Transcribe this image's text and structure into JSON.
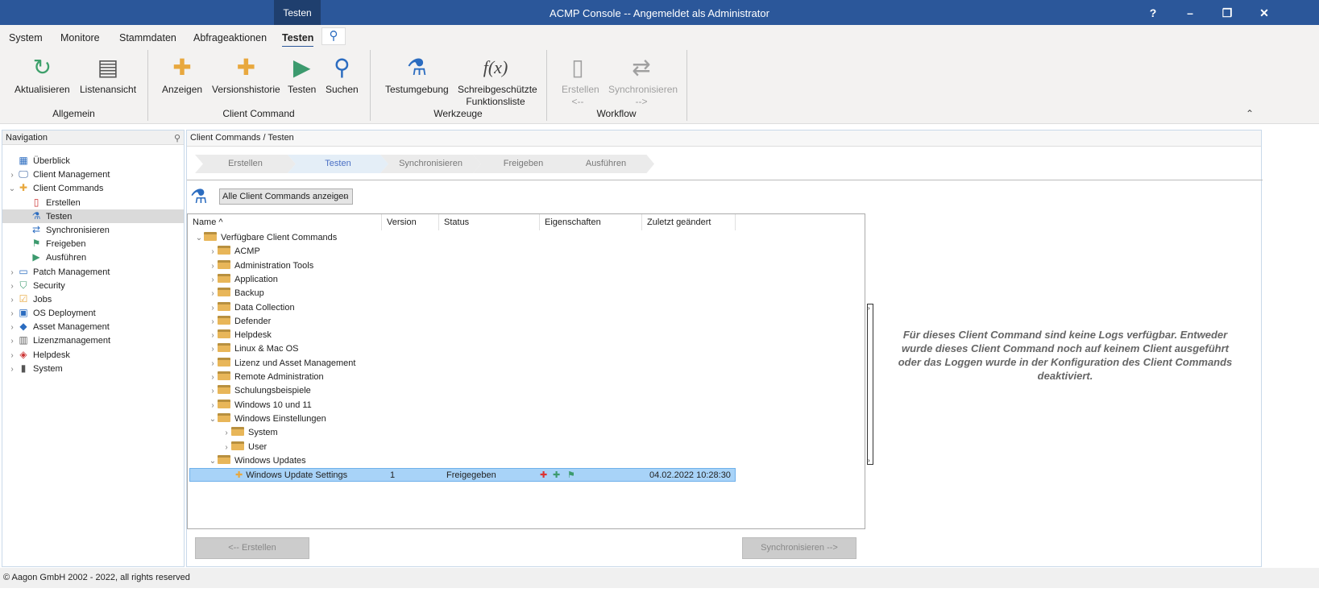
{
  "window": {
    "context_tab": "Testen",
    "title": "ACMP Console -- Angemeldet als Administrator",
    "help": "?",
    "minimize": "–",
    "restore": "❐",
    "close": "✕"
  },
  "menu": {
    "tabs": [
      "System",
      "Monitore",
      "Stammdaten",
      "Abfrageaktionen",
      "Testen"
    ],
    "active": "Testen"
  },
  "ribbon": {
    "buttons": [
      {
        "label": "Aktualisieren",
        "icon": "refresh-icon"
      },
      {
        "label": "Listenansicht",
        "icon": "list-view-icon"
      },
      {
        "label": "Anzeigen",
        "icon": "puzzle-search-icon"
      },
      {
        "label": "Versionshistorie",
        "icon": "puzzle-info-icon"
      },
      {
        "label": "Testen",
        "icon": "play-icon"
      },
      {
        "label": "Suchen",
        "icon": "search-icon"
      },
      {
        "label": "Testumgebung",
        "icon": "flask-gear-icon"
      },
      {
        "label": "Schreibgeschützte Funktionsliste",
        "icon": "function-search-icon"
      },
      {
        "label": "Erstellen <--",
        "icon": "document-icon",
        "disabled": true
      },
      {
        "label": "Synchronisieren -->",
        "icon": "sync-arrows-icon",
        "disabled": true
      }
    ],
    "groups": [
      "Allgemein",
      "Client Command",
      "Werkzeuge",
      "Workflow"
    ]
  },
  "navigation": {
    "title": "Navigation",
    "items": [
      {
        "label": "Überblick",
        "icon": "overview-icon",
        "level": 0,
        "chevron": ""
      },
      {
        "label": "Client Management",
        "icon": "monitor-icon",
        "level": 0,
        "chevron": ">"
      },
      {
        "label": "Client Commands",
        "icon": "puzzle-icon",
        "level": 0,
        "chevron": "v"
      },
      {
        "label": "Erstellen",
        "icon": "document-icon",
        "level": 1,
        "chevron": ""
      },
      {
        "label": "Testen",
        "icon": "flask-icon",
        "level": 1,
        "chevron": "",
        "selected": true
      },
      {
        "label": "Synchronisieren",
        "icon": "sync-icon",
        "level": 1,
        "chevron": ""
      },
      {
        "label": "Freigeben",
        "icon": "flag-icon",
        "level": 1,
        "chevron": ""
      },
      {
        "label": "Ausführen",
        "icon": "play-icon",
        "level": 1,
        "chevron": ""
      },
      {
        "label": "Patch Management",
        "icon": "patch-icon",
        "level": 0,
        "chevron": ">"
      },
      {
        "label": "Security",
        "icon": "shield-icon",
        "level": 0,
        "chevron": ">"
      },
      {
        "label": "Jobs",
        "icon": "clipboard-icon",
        "level": 0,
        "chevron": ">"
      },
      {
        "label": "OS Deployment",
        "icon": "deploy-icon",
        "level": 0,
        "chevron": ">"
      },
      {
        "label": "Asset Management",
        "icon": "asset-icon",
        "level": 0,
        "chevron": ">"
      },
      {
        "label": "Lizenzmanagement",
        "icon": "license-icon",
        "level": 0,
        "chevron": ">"
      },
      {
        "label": "Helpdesk",
        "icon": "ticket-icon",
        "level": 0,
        "chevron": ">"
      },
      {
        "label": "System",
        "icon": "server-icon",
        "level": 0,
        "chevron": ">"
      }
    ]
  },
  "content": {
    "breadcrumb": "Client Commands / Testen",
    "steps": [
      "Erstellen",
      "Testen",
      "Synchronisieren",
      "Freigeben",
      "Ausführen"
    ],
    "active_step": "Testen",
    "filter": "Alle Client Commands anzeigen",
    "columns": [
      "Name",
      "Version",
      "Status",
      "Eigenschaften",
      "Zuletzt geändert"
    ],
    "tree": [
      {
        "label": "Verfügbare Client Commands",
        "level": 0,
        "chevron": "v"
      },
      {
        "label": "ACMP",
        "level": 1,
        "chevron": ">"
      },
      {
        "label": "Administration Tools",
        "level": 1,
        "chevron": ">"
      },
      {
        "label": "Application",
        "level": 1,
        "chevron": ">"
      },
      {
        "label": "Backup",
        "level": 1,
        "chevron": ">"
      },
      {
        "label": "Data Collection",
        "level": 1,
        "chevron": ">"
      },
      {
        "label": "Defender",
        "level": 1,
        "chevron": ">"
      },
      {
        "label": "Helpdesk",
        "level": 1,
        "chevron": ">"
      },
      {
        "label": "Linux & Mac OS",
        "level": 1,
        "chevron": ">"
      },
      {
        "label": "Lizenz und Asset Management",
        "level": 1,
        "chevron": ">"
      },
      {
        "label": "Remote Administration",
        "level": 1,
        "chevron": ">"
      },
      {
        "label": "Schulungsbeispiele",
        "level": 1,
        "chevron": ">"
      },
      {
        "label": "Windows 10 und 11",
        "level": 1,
        "chevron": ">"
      },
      {
        "label": "Windows Einstellungen",
        "level": 1,
        "chevron": "v"
      },
      {
        "label": "System",
        "level": 2,
        "chevron": ">"
      },
      {
        "label": "User",
        "level": 2,
        "chevron": ">"
      },
      {
        "label": "Windows Updates",
        "level": 1,
        "chevron": "v"
      },
      {
        "label": "Windows Update Settings",
        "level": 2,
        "chevron": "",
        "item": true,
        "selected": true,
        "version": "1",
        "status": "Freigegeben",
        "modified": "04.02.2022 10:28:30"
      }
    ],
    "back_button": "<-- Erstellen",
    "next_button": "Synchronisieren -->",
    "log_message": "Für dieses Client Command sind keine Logs verfügbar. Entweder wurde dieses Client Command noch auf keinem Client ausgeführt oder das Loggen wurde in der Konfiguration des Client Commands deaktiviert."
  },
  "status": "© Aagon GmbH 2002 - 2022, all rights reserved",
  "colors": {
    "accent": "#2b579a",
    "selection": "#a8d3f8"
  }
}
